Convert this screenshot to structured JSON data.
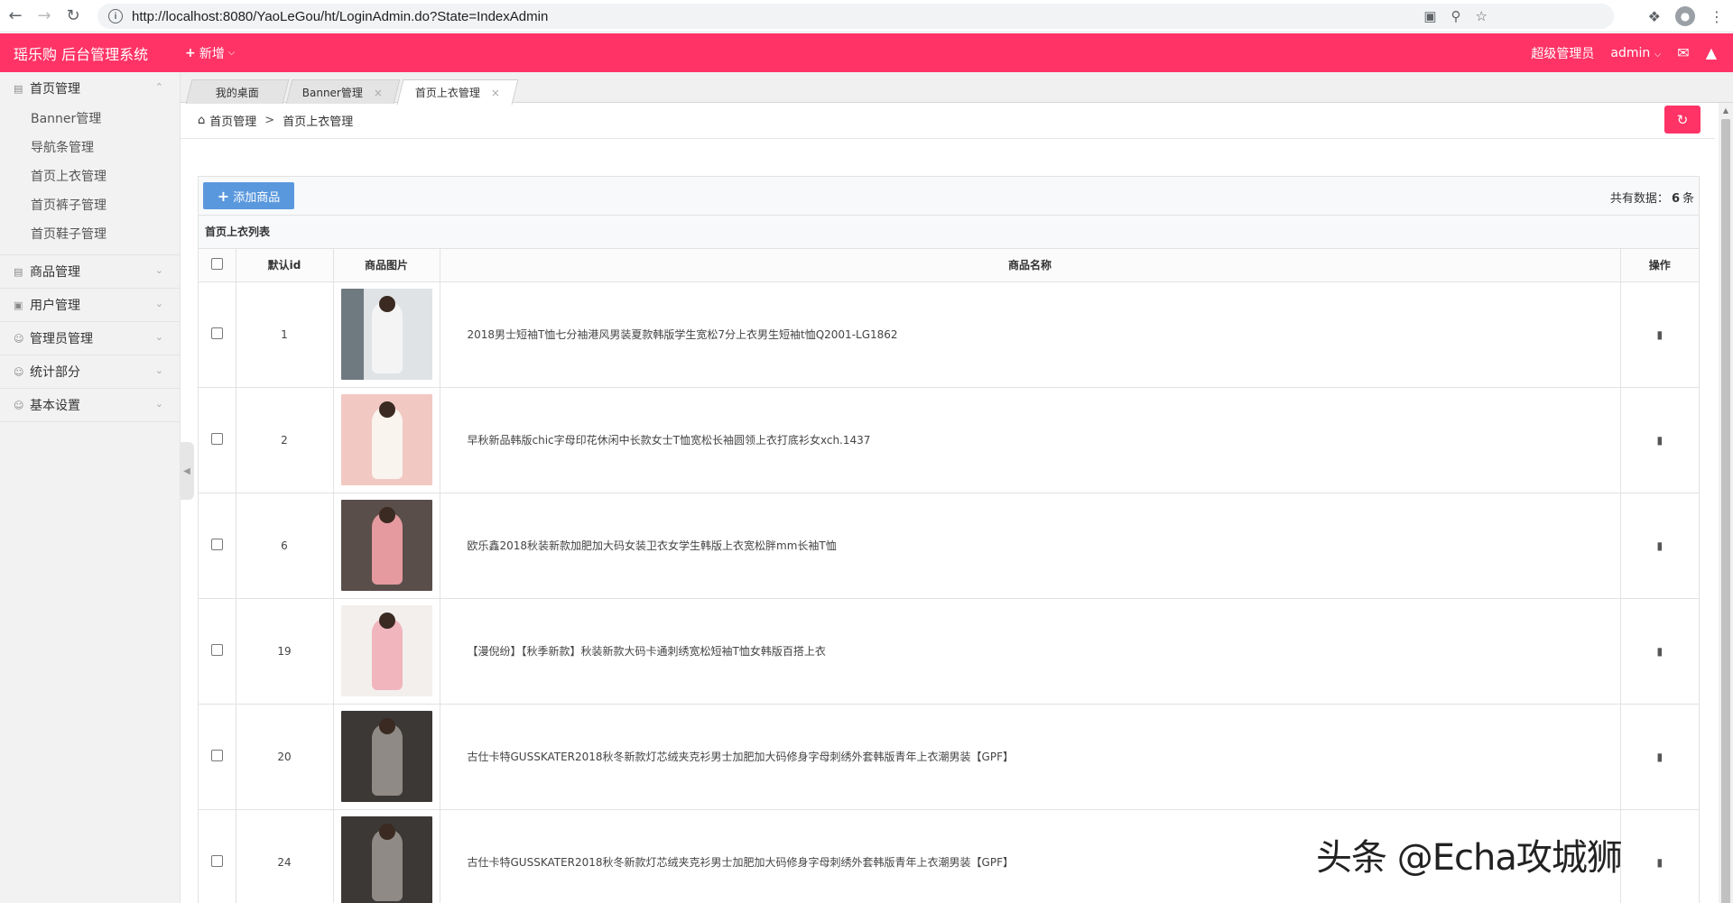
{
  "browser": {
    "url": "http://localhost:8080/YaoLeGou/ht/LoginAdmin.do?State=IndexAdmin"
  },
  "header": {
    "title": "瑶乐购 后台管理系统",
    "new_label": "新增",
    "role": "超级管理员",
    "user": "admin"
  },
  "sidebar": {
    "groups": [
      {
        "label": "首页管理",
        "items": [
          "Banner管理",
          "导航条管理",
          "首页上衣管理",
          "首页裤子管理",
          "首页鞋子管理"
        ]
      },
      {
        "label": "商品管理"
      },
      {
        "label": "用户管理"
      },
      {
        "label": "管理员管理"
      },
      {
        "label": "统计部分"
      },
      {
        "label": "基本设置"
      }
    ]
  },
  "tabs": [
    {
      "label": "我的桌面"
    },
    {
      "label": "Banner管理"
    },
    {
      "label": "首页上衣管理"
    }
  ],
  "breadcrumb": {
    "home": "首页管理",
    "separator": ">",
    "current": "首页上衣管理"
  },
  "toolbar": {
    "add_label": "添加商品",
    "count_prefix": "共有数据：",
    "count_value": "6",
    "count_suffix": "条"
  },
  "list": {
    "title": "首页上衣列表",
    "columns": [
      "默认id",
      "商品图片",
      "商品名称",
      "操作"
    ],
    "rows": [
      {
        "id": "1",
        "name": "2018男士短袖T恤七分袖港风男装夏款韩版学生宽松7分上衣男生短袖t恤Q2001-LG1862"
      },
      {
        "id": "2",
        "name": "早秋新品韩版chic字母印花休闲中长款女士T恤宽松长袖圆领上衣打底衫女xch.1437"
      },
      {
        "id": "6",
        "name": "欧乐鑫2018秋装新款加肥加大码女装卫衣女学生韩版上衣宽松胖mm长袖T恤"
      },
      {
        "id": "19",
        "name": "【漫倪纷】【秋季新款】秋装新款大码卡通刺绣宽松短袖T恤女韩版百搭上衣"
      },
      {
        "id": "20",
        "name": "古仕卡特GUSSKATER2018秋冬新款灯芯绒夹克衫男士加肥加大码修身字母刺绣外套韩版青年上衣潮男装【GPF】"
      },
      {
        "id": "24",
        "name": "古仕卡特GUSSKATER2018秋冬新款灯芯绒夹克衫男士加肥加大码修身字母刺绣外套韩版青年上衣潮男装【GPF】"
      }
    ]
  },
  "watermark": "头条 @Echa攻城狮"
}
